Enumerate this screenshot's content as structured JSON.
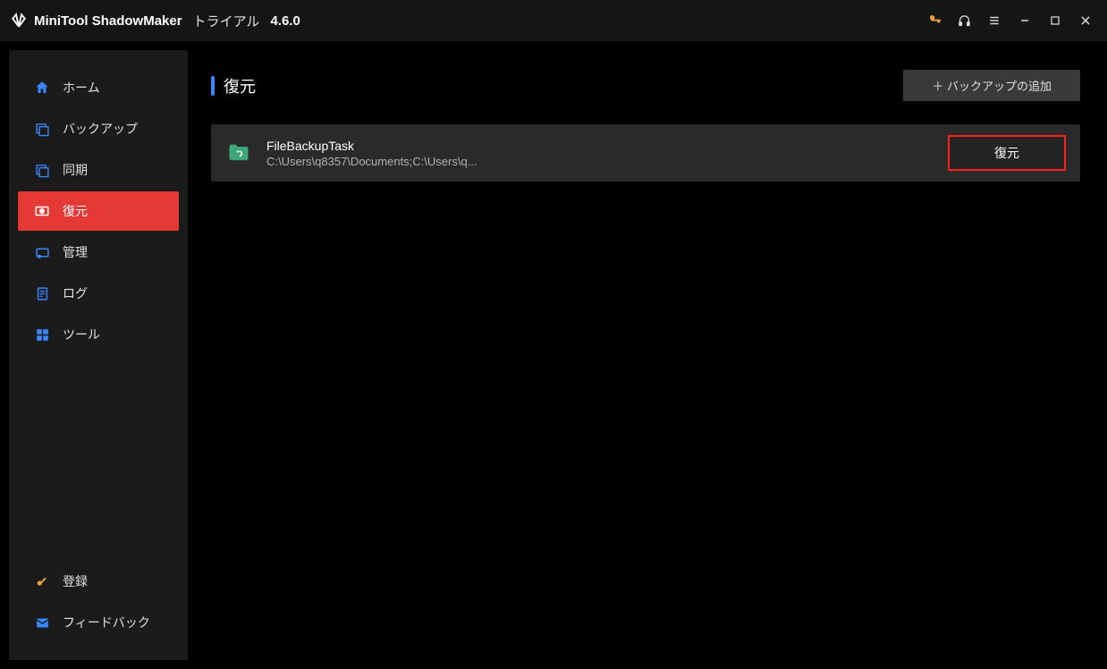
{
  "header": {
    "app_name": "MiniTool ShadowMaker",
    "trial_label": "トライアル",
    "version": "4.6.0"
  },
  "sidebar": {
    "items": [
      {
        "id": "home",
        "label": "ホーム"
      },
      {
        "id": "backup",
        "label": "バックアップ"
      },
      {
        "id": "sync",
        "label": "同期"
      },
      {
        "id": "restore",
        "label": "復元"
      },
      {
        "id": "manage",
        "label": "管理"
      },
      {
        "id": "log",
        "label": "ログ"
      },
      {
        "id": "tools",
        "label": "ツール"
      }
    ],
    "bottom": [
      {
        "id": "register",
        "label": "登録"
      },
      {
        "id": "feedback",
        "label": "フィードバック"
      }
    ]
  },
  "page": {
    "title": "復元",
    "add_backup_label": "＋ バックアップの追加"
  },
  "tasks": [
    {
      "name": "FileBackupTask",
      "path": "C:\\Users\\q8357\\Documents;C:\\Users\\q...",
      "restore_label": "復元"
    }
  ]
}
